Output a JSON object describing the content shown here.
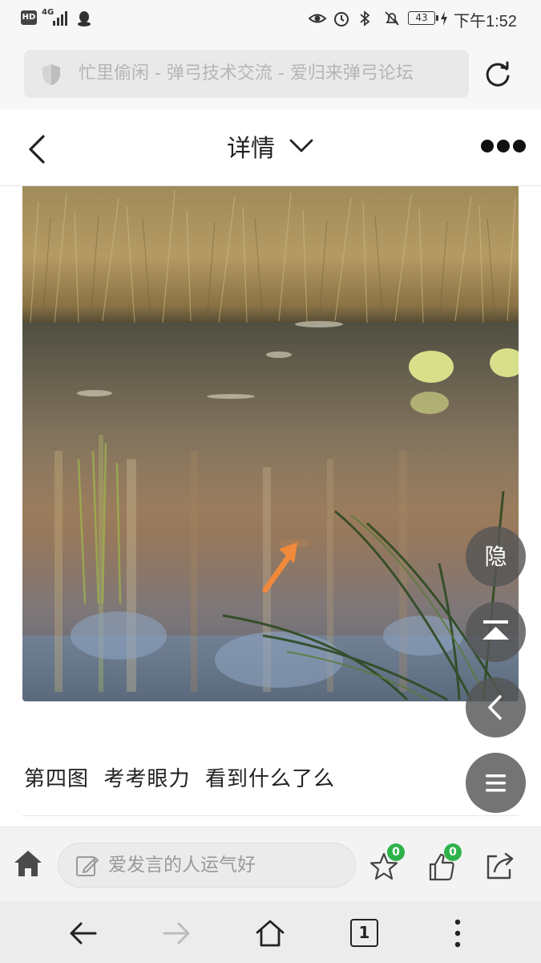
{
  "status_bar": {
    "hd": "HD",
    "network": "4G",
    "battery": "43",
    "time": "下午1:52"
  },
  "address_bar": {
    "url_text": "忙里偷闲 - 弹弓技术交流 - 爱归来弹弓论坛"
  },
  "header": {
    "title": "详情"
  },
  "post": {
    "caption": "第四图  考考眼力  看到什么了么"
  },
  "floating_buttons": {
    "hide_label": "隐"
  },
  "action_bar": {
    "comment_placeholder": "爱发言的人运气好",
    "favorite_count": "0",
    "like_count": "0"
  },
  "nav_bar": {
    "tab_count": "1"
  },
  "colors": {
    "badge": "#2eb34a",
    "arrow": "#f08a3a",
    "fab": "#555555"
  }
}
